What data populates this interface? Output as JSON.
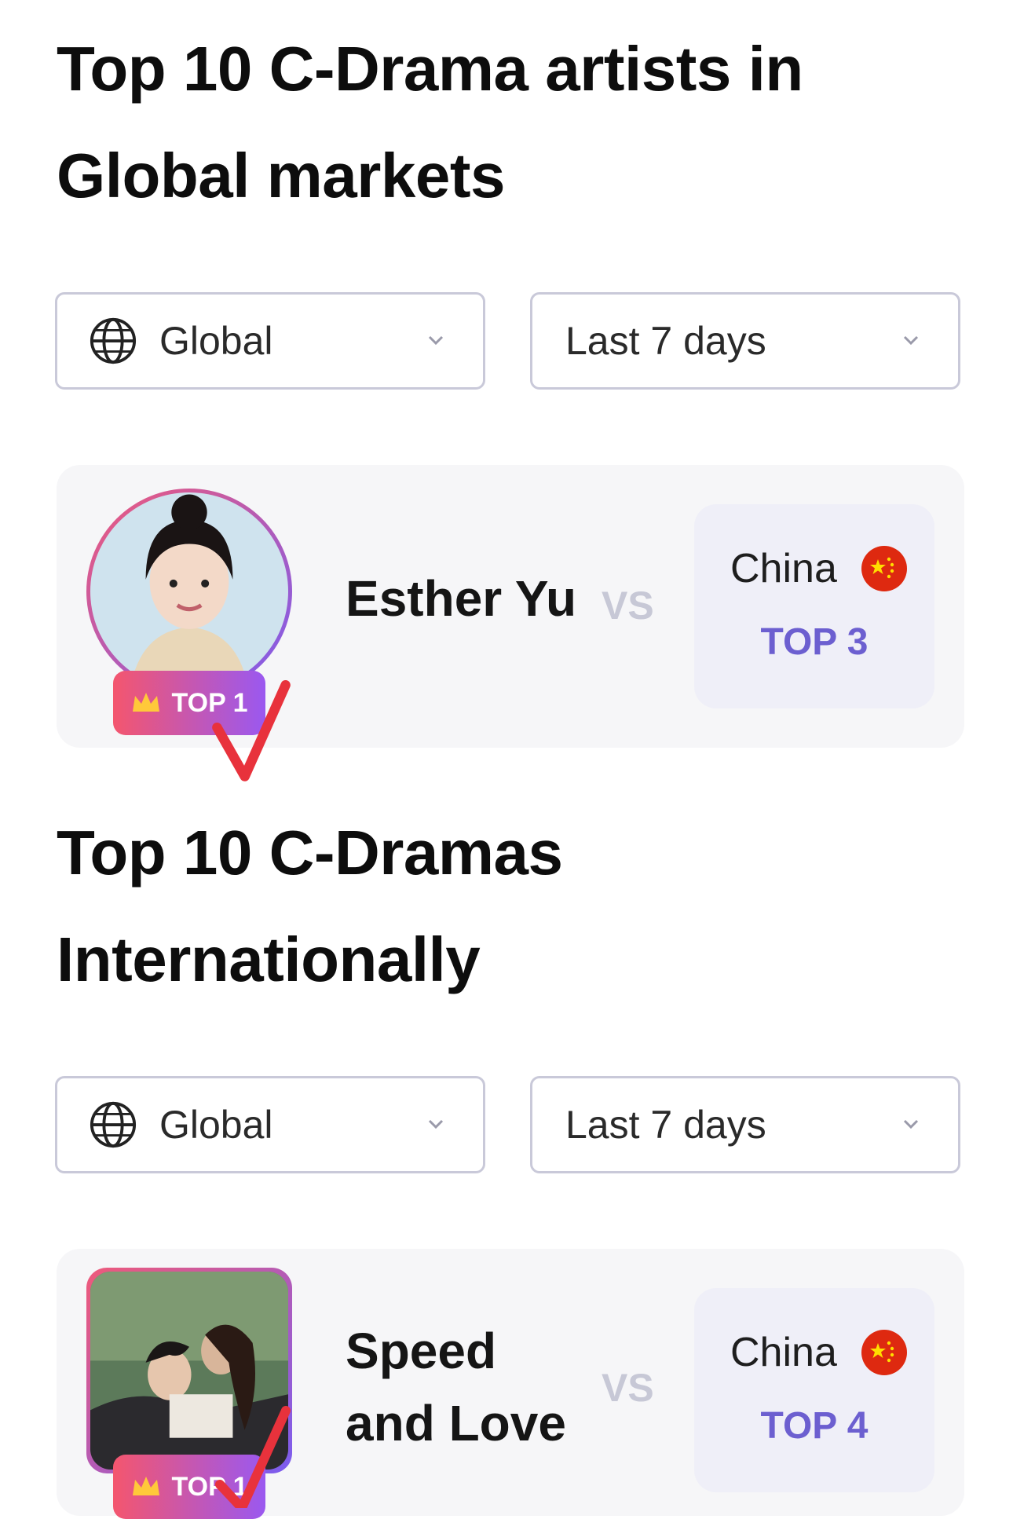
{
  "sections": [
    {
      "title_line1": "Top 10 C-Drama artists in",
      "title_line2": "Global markets",
      "region_filter": {
        "value": "Global",
        "icon": "globe-icon"
      },
      "period_filter": {
        "value": "Last 7 days"
      },
      "item": {
        "name_line1": "Esther Yu",
        "name_line2": "",
        "rank_badge": "TOP 1",
        "vs": "VS",
        "country": "China",
        "country_rank": "TOP 3"
      }
    },
    {
      "title_line1": "Top 10 C-Dramas",
      "title_line2": "Internationally",
      "region_filter": {
        "value": "Global",
        "icon": "globe-icon"
      },
      "period_filter": {
        "value": "Last 7 days"
      },
      "item": {
        "name_line1": "Speed",
        "name_line2": "and Love",
        "rank_badge": "TOP 1",
        "vs": "VS",
        "country": "China",
        "country_rank": "TOP 4"
      }
    }
  ],
  "colors": {
    "badge_gradient_start": "#f4566e",
    "badge_gradient_end": "#9a58f0",
    "rank_text": "#6c5fd0",
    "check_mark": "#e8323c",
    "flag_red": "#de2910",
    "flag_yellow": "#ffde00"
  }
}
